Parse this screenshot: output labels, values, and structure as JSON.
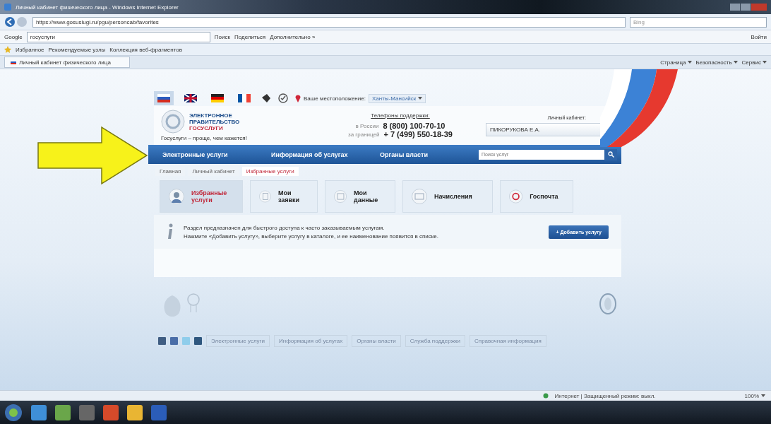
{
  "browser": {
    "title": "Личный кабинет физического лица - Windows Internet Explorer",
    "address": "https://www.gosuslugi.ru/pgu/personcab/favorites",
    "search_placeholder": "Bing",
    "search_engine": "Google",
    "search_query": "госуслуги",
    "toolbar_buttons": [
      "Поиск",
      "Поделиться",
      "Дополнительно »"
    ],
    "signin": "Войти",
    "favorites": "Избранное",
    "favorite_links": [
      "Рекомендуемые узлы",
      "Коллекция веб-фрагментов"
    ],
    "tab": "Личный кабинет физического лица",
    "command_menus": [
      "Страница",
      "Безопасность",
      "Сервис"
    ]
  },
  "site": {
    "languages": [
      {
        "kind": "ru",
        "selected": true
      },
      {
        "kind": "uk",
        "selected": false
      },
      {
        "kind": "de",
        "selected": false
      },
      {
        "kind": "fr",
        "selected": false
      }
    ],
    "location_label": "Ваше местоположение:",
    "location": "Ханты-Мансийск",
    "logo": {
      "line1": "ЭЛЕКТРОННОЕ",
      "line2": "ПРАВИТЕЛЬСТВО",
      "line3": "ГОСУСЛУГИ",
      "slogan": "Госуслуги – проще, чем кажется!"
    },
    "phones": {
      "title": "Телефоны поддержки:",
      "rows": [
        {
          "region": "в России",
          "number": "8 (800) 100-70-10"
        },
        {
          "region": "за границей",
          "number": "+ 7 (499) 550-18-39"
        }
      ]
    },
    "cabinet": {
      "label": "Личный кабинет:",
      "user": "ПИКОРУКОВА Е.А."
    },
    "nav": [
      "Электронные услуги",
      "Информация об услугах",
      "Органы власти"
    ],
    "search": {
      "placeholder": "Поиск услуг"
    },
    "breadcrumbs": [
      {
        "label": "Главная",
        "selected": false
      },
      {
        "label": "Личный кабинет",
        "selected": false
      },
      {
        "label": "Избранные услуги",
        "selected": true
      }
    ],
    "sections": [
      {
        "kind": "favorites",
        "label": "Избранные услуги",
        "selected": true
      },
      {
        "kind": "orders",
        "label": "Мои заявки",
        "selected": false
      },
      {
        "kind": "data",
        "label": "Мои данные",
        "selected": false
      },
      {
        "kind": "charges",
        "label": "Начисления",
        "selected": false
      },
      {
        "kind": "mail",
        "label": "Госпочта",
        "selected": false
      }
    ],
    "info": [
      "Раздел предназначен для быстрого доступа к часто заказываемым услугам.",
      "Нажмите «Добавить услугу», выберите услугу в каталоге, и ее наименование появится в списке."
    ],
    "add_button": {
      "icon": "+",
      "label": "Добавить услугу"
    },
    "social": [
      {
        "kind": "ok"
      },
      {
        "kind": "fb"
      },
      {
        "kind": "tw"
      },
      {
        "kind": "vk"
      }
    ],
    "footer_links": [
      "Электронные услуги",
      "Информация об услугах",
      "Органы власти",
      "Служба поддержки",
      "Справочная информация"
    ]
  },
  "status_bar": {
    "zone": "Интернет | Защищенный режим: выкл.",
    "zoom": "100%"
  }
}
